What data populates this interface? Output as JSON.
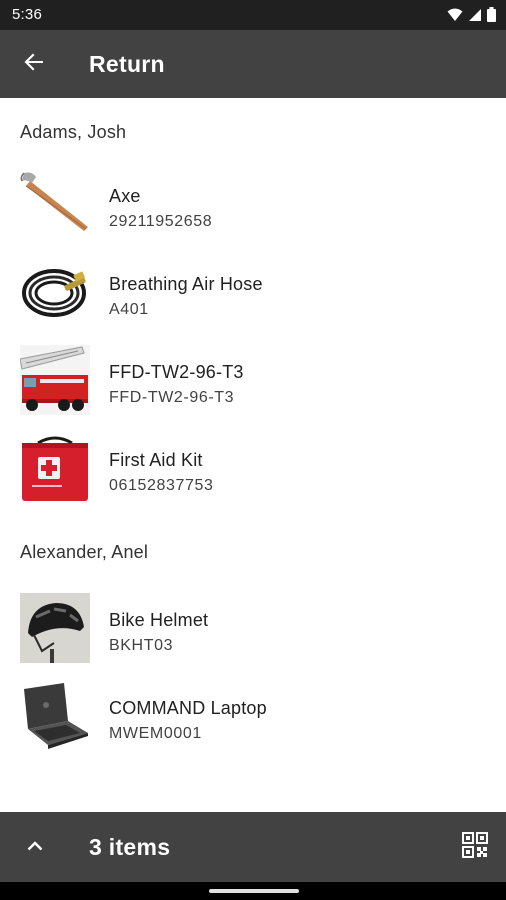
{
  "status_bar": {
    "time": "5:36",
    "icons": [
      "wifi-icon",
      "cell-signal-icon",
      "battery-icon"
    ]
  },
  "app_bar": {
    "title": "Return",
    "back_icon": "arrow-back-icon"
  },
  "groups": [
    {
      "person": "Adams, Josh",
      "items": [
        {
          "name": "Axe",
          "code": "29211952658",
          "thumb_icon": "axe-image"
        },
        {
          "name": "Breathing Air Hose",
          "code": "A401",
          "thumb_icon": "air-hose-image"
        },
        {
          "name": "FFD-TW2-96-T3",
          "code": "FFD-TW2-96-T3",
          "thumb_icon": "fire-truck-image"
        },
        {
          "name": "First Aid Kit",
          "code": "06152837753",
          "thumb_icon": "first-aid-kit-image"
        }
      ]
    },
    {
      "person": "Alexander, Anel",
      "items": [
        {
          "name": "Bike Helmet",
          "code": "BKHT03",
          "thumb_icon": "bike-helmet-image"
        },
        {
          "name": "COMMAND Laptop",
          "code": "MWEM0001",
          "thumb_icon": "laptop-image"
        }
      ]
    }
  ],
  "bottom_bar": {
    "count_label": "3 items",
    "expand_icon": "chevron-up-icon",
    "scan_icon": "qr-code-icon"
  },
  "colors": {
    "status_bar": "#202020",
    "app_bar": "#424242",
    "background": "#ffffff"
  }
}
